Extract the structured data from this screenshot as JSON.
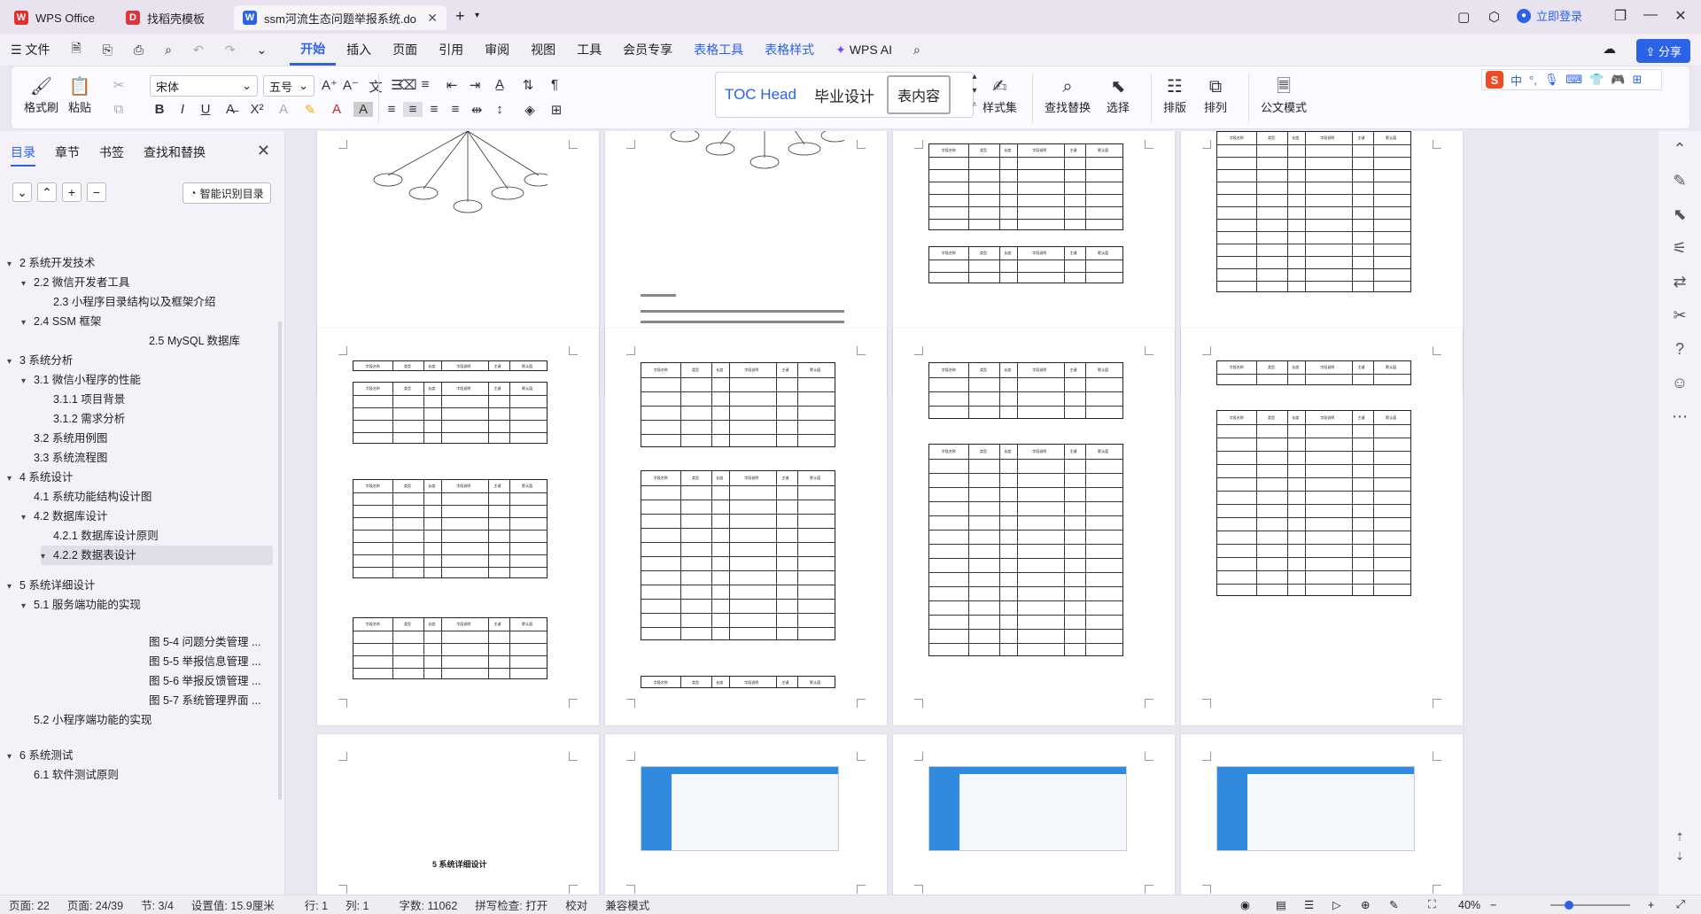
{
  "titlebar": {
    "tabs": [
      {
        "label": "WPS Office",
        "logo": "W"
      },
      {
        "label": "找稻壳模板",
        "logo": "D"
      },
      {
        "label": "ssm河流生态问题举报系统.do",
        "logo": "W"
      }
    ],
    "new_tab": "+",
    "login": "立即登录"
  },
  "menubar": {
    "file": "文件",
    "items": [
      "开始",
      "插入",
      "页面",
      "引用",
      "审阅",
      "视图",
      "工具",
      "会员专享"
    ],
    "tools": [
      "表格工具",
      "表格样式"
    ],
    "wps_ai": "WPS AI",
    "share": "分享"
  },
  "ribbon": {
    "format_painter": "格式刷",
    "paste": "粘贴",
    "font_name": "宋体",
    "font_size": "五号",
    "styles": [
      "TOC Head",
      "毕业设计（论",
      "表内容"
    ],
    "style_set": "样式集",
    "find_replace": "查找替换",
    "select": "选择",
    "layout": "排版",
    "arrange": "排列",
    "official": "公文模式"
  },
  "ime": {
    "logo": "S",
    "mode": "中"
  },
  "sidepanel": {
    "tabs": [
      "目录",
      "章节",
      "书签",
      "查找和替换"
    ],
    "smart_button": "智能识别目录",
    "toc": [
      {
        "text": "2 系统开发技术",
        "level": 1,
        "arrow": "▾"
      },
      {
        "text": "2.2 微信开发者工具",
        "level": 2,
        "arrow": "▾"
      },
      {
        "text": "2.3 小程序目录结构以及框架介绍",
        "level": 3,
        "arrow": ""
      },
      {
        "text": "2.4 SSM 框架",
        "level": 2,
        "arrow": "▾"
      },
      {
        "text": "2.5 MySQL 数据库",
        "level": 5,
        "arrow": ""
      },
      {
        "text": "3 系统分析",
        "level": 1,
        "arrow": "▾"
      },
      {
        "text": "3.1 微信小程序的性能",
        "level": 2,
        "arrow": "▾"
      },
      {
        "text": "3.1.1 项目背景",
        "level": 3,
        "arrow": ""
      },
      {
        "text": "3.1.2 需求分析",
        "level": 3,
        "arrow": ""
      },
      {
        "text": "3.2 系统用例图",
        "level": 2,
        "arrow": ""
      },
      {
        "text": "3.3  系统流程图",
        "level": 2,
        "arrow": ""
      },
      {
        "text": "4  系统设计",
        "level": 1,
        "arrow": "▾"
      },
      {
        "text": "4.1 系统功能结构设计图",
        "level": 2,
        "arrow": ""
      },
      {
        "text": "4.2 数据库设计",
        "level": 2,
        "arrow": "▾"
      },
      {
        "text": "4.2.1 数据库设计原则",
        "level": 3,
        "arrow": ""
      },
      {
        "text": "4.2.2    数据表设计",
        "level": 3,
        "arrow": "▾"
      },
      {
        "text": "5 系统详细设计",
        "level": 1,
        "arrow": "▾"
      },
      {
        "text": "5.1  服务端功能的实现",
        "level": 2,
        "arrow": "▾"
      },
      {
        "text": "图 5-4 问题分类管理 ...",
        "level": 5,
        "arrow": ""
      },
      {
        "text": "图 5-5 举报信息管理 ...",
        "level": 5,
        "arrow": ""
      },
      {
        "text": "图 5-6 举报反馈管理 ...",
        "level": 5,
        "arrow": ""
      },
      {
        "text": "图 5-7 系统管理界面 ...",
        "level": 5,
        "arrow": ""
      },
      {
        "text": "5.2 小程序端功能的实现",
        "level": 2,
        "arrow": ""
      },
      {
        "text": "6  系统测试",
        "level": 1,
        "arrow": "▾"
      },
      {
        "text": "6.1 软件测试原则",
        "level": 2,
        "arrow": ""
      }
    ]
  },
  "document": {
    "heading_5": "5 系统详细设计",
    "field_header": [
      "字段名称",
      "类型",
      "长度",
      "字段说明",
      "主键",
      "默认值"
    ]
  },
  "statusbar": {
    "page": "页面: 22",
    "pages": "页面: 24/39",
    "section": "节: 3/4",
    "setting": "设置值: 15.9厘米",
    "row": "行: 1",
    "col": "列: 1",
    "words": "字数: 11062",
    "spell": "拼写检查: 打开",
    "proof": "校对",
    "compat": "兼容模式",
    "zoom": "40%"
  },
  "colors": {
    "accent": "#2b62e8",
    "app_blue": "#2f8ae0"
  }
}
